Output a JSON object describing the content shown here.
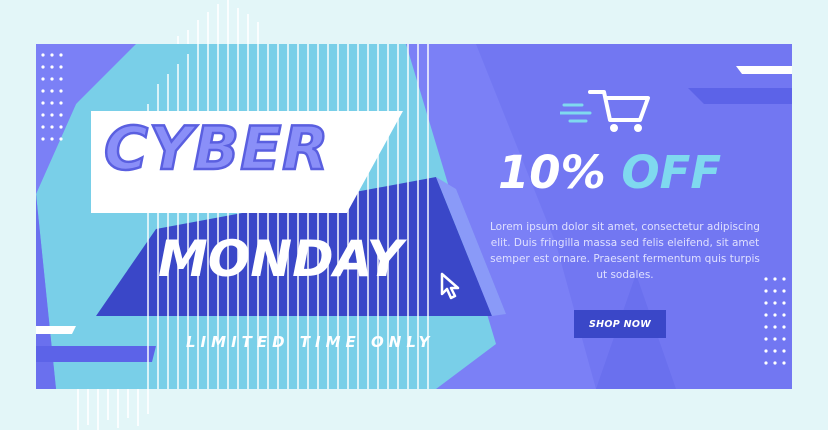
{
  "banner": {
    "headline_line1": "CYBER",
    "headline_line2": "MONDAY",
    "tagline": "LIMITED TIME ONLY",
    "discount_value": "10%",
    "discount_word": "OFF",
    "description": "Lorem ipsum dolor sit amet, consectetur adipiscing elit. Duis fringilla massa sed felis eleifend, sit amet semper est ornare. Praesent fermentum quis turpis ut sodales.",
    "cta_label": "SHOP NOW"
  },
  "icons": {
    "cart": "shopping-cart-icon",
    "cursor": "mouse-cursor-icon"
  },
  "colors": {
    "background": "#e3f6f8",
    "primary_purple": "#7b80f6",
    "dark_blue": "#3a47c8",
    "cyan": "#7fd9ef",
    "white": "#ffffff"
  }
}
